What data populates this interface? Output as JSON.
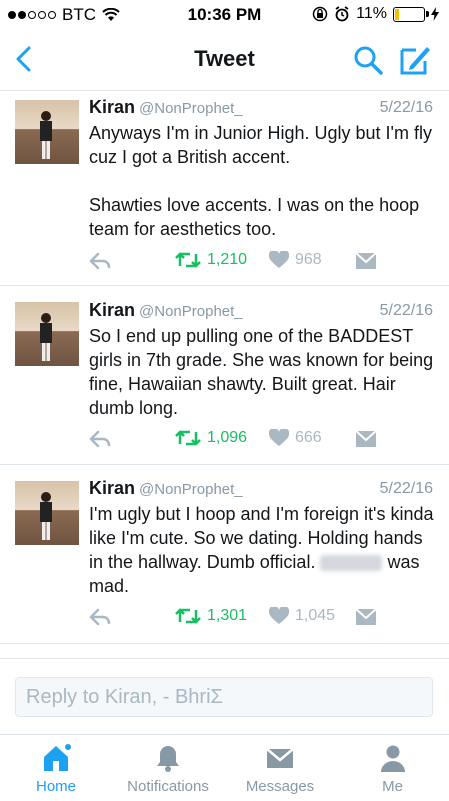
{
  "status_bar": {
    "carrier": "BTC",
    "time": "10:36 PM",
    "battery": "11%"
  },
  "nav": {
    "title": "Tweet"
  },
  "tweets": [
    {
      "name": "Kiran",
      "handle": "@NonProphet_",
      "date": "5/22/16",
      "text_p1": "Anyways I'm in Junior High. Ugly but I'm fly cuz I got a British accent.",
      "text_p2": "Shawties love accents. I was on the hoop team for aesthetics too.",
      "retweets": "1,210",
      "likes": "968"
    },
    {
      "name": "Kiran",
      "handle": "@NonProphet_",
      "date": "5/22/16",
      "text_p1": "So I end up pulling one of the BADDEST girls in 7th grade. She was known for being fine, Hawaiian shawty. Built great. Hair dumb long.",
      "retweets": "1,096",
      "likes": "666"
    },
    {
      "name": "Kiran",
      "handle": "@NonProphet_",
      "date": "5/22/16",
      "text_a": "I'm ugly but I hoop and I'm foreign it's kinda like I'm cute. So we dating. Holding hands in the hallway. Dumb official.",
      "text_b": "was mad.",
      "retweets": "1,301",
      "likes": "1,045"
    }
  ],
  "reply": {
    "placeholder": "Reply to Kiran, - BhriΣ"
  },
  "tabs": [
    {
      "label": "Home",
      "icon": "home-icon"
    },
    {
      "label": "Notifications",
      "icon": "bell-icon"
    },
    {
      "label": "Messages",
      "icon": "envelope-icon"
    },
    {
      "label": "Me",
      "icon": "person-icon"
    }
  ],
  "colors": {
    "accent": "#1da1f2",
    "retweet": "#17bf63",
    "muted": "#8899a6"
  }
}
